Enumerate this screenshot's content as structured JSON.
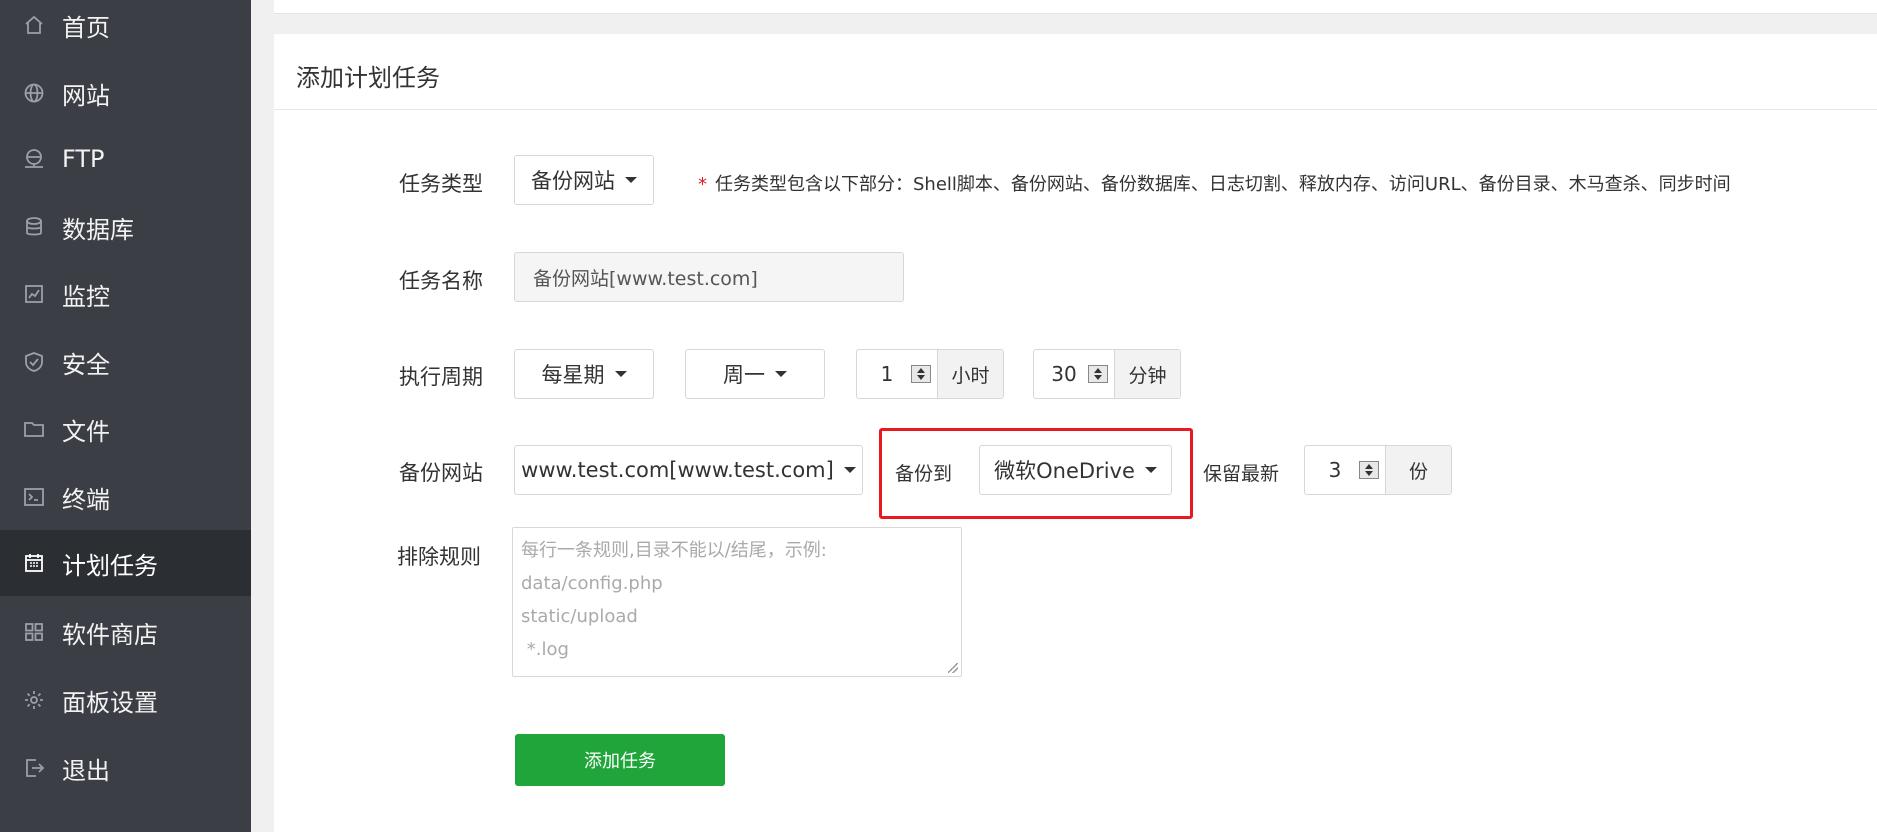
{
  "sidebar": {
    "items": [
      {
        "label": "首页",
        "icon": "home-icon"
      },
      {
        "label": "网站",
        "icon": "globe-icon"
      },
      {
        "label": "FTP",
        "icon": "ftp-icon"
      },
      {
        "label": "数据库",
        "icon": "database-icon"
      },
      {
        "label": "监控",
        "icon": "monitor-icon"
      },
      {
        "label": "安全",
        "icon": "shield-icon"
      },
      {
        "label": "文件",
        "icon": "folder-icon"
      },
      {
        "label": "终端",
        "icon": "terminal-icon"
      },
      {
        "label": "计划任务",
        "icon": "calendar-icon",
        "active": true
      },
      {
        "label": "软件商店",
        "icon": "grid-icon"
      },
      {
        "label": "面板设置",
        "icon": "gear-icon"
      },
      {
        "label": "退出",
        "icon": "logout-icon"
      }
    ]
  },
  "card": {
    "title": "添加计划任务"
  },
  "form": {
    "task_type": {
      "label": "任务类型",
      "value": "备份网站",
      "hint_star": "*",
      "hint": "任务类型包含以下部分：Shell脚本、备份网站、备份数据库、日志切割、释放内存、访问URL、备份目录、木马查杀、同步时间"
    },
    "task_name": {
      "label": "任务名称",
      "value": "备份网站[www.test.com]"
    },
    "period": {
      "label": "执行周期",
      "frequency": "每星期",
      "weekday": "周一",
      "hour_value": "1",
      "hour_unit": "小时",
      "minute_value": "30",
      "minute_unit": "分钟"
    },
    "backup_site": {
      "label": "备份网站",
      "site": "www.test.com[www.test.com]",
      "backup_to_label": "备份到",
      "backup_to": "微软OneDrive",
      "keep_label": "保留最新",
      "keep_value": "3",
      "keep_unit": "份"
    },
    "exclude": {
      "label": "排除规则",
      "placeholder": "每行一条规则,目录不能以/结尾，示例:\ndata/config.php\nstatic/upload\n *.log"
    },
    "submit_label": "添加任务"
  },
  "colors": {
    "sidebar_bg": "#3b3f45",
    "active_bg": "#2b2e33",
    "accent": "#20a53a",
    "highlight": "#e8191f"
  }
}
